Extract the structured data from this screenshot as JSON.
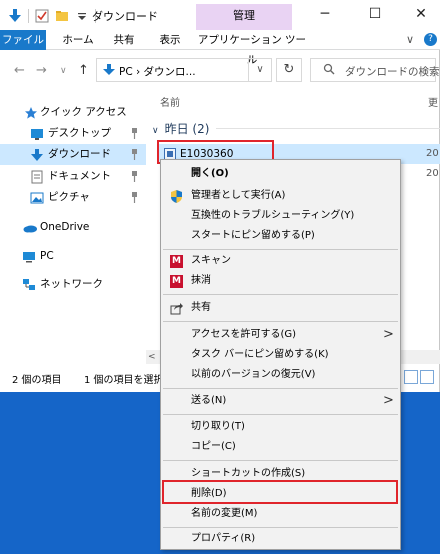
{
  "window": {
    "title": "ダウンロード",
    "manage_tab": "管理",
    "min": "─",
    "max": "☐",
    "close": "✕"
  },
  "ribbon": {
    "tabs": [
      "ファイル",
      "ホーム",
      "共有",
      "表示",
      "アプリケーション ツール"
    ],
    "expand": "∨",
    "help": "?"
  },
  "address": {
    "back": "←",
    "forward": "→",
    "recent": "∨",
    "up": "↑",
    "path": "PC  ›  ダウンロ...",
    "dropdown": "∨",
    "refresh": "↻",
    "search_placeholder": "ダウンロードの検索"
  },
  "nav": {
    "items": [
      {
        "label": "クイック アクセス",
        "icon": "star-icon"
      },
      {
        "label": "デスクトップ",
        "icon": "desktop-folder-icon",
        "pinned": true
      },
      {
        "label": "ダウンロード",
        "icon": "download-folder-icon",
        "pinned": true,
        "selected": true
      },
      {
        "label": "ドキュメント",
        "icon": "documents-folder-icon",
        "pinned": true
      },
      {
        "label": "ピクチャ",
        "icon": "pictures-folder-icon",
        "pinned": true
      },
      {
        "label": "OneDrive",
        "icon": "onedrive-icon"
      },
      {
        "label": "PC",
        "icon": "pc-icon"
      },
      {
        "label": "ネットワーク",
        "icon": "network-icon"
      }
    ],
    "pin_glyph": "📌"
  },
  "content": {
    "column_name": "名前",
    "column_more": "更",
    "group_label": "昨日 (2)",
    "group_chevron": "∨",
    "selected_file": "E1030360",
    "selected_file_date": "20",
    "second_file_date": "20"
  },
  "status": {
    "item_count": "2 個の項目",
    "selected_count": "1 個の項目を選択",
    "scroll_left": "<"
  },
  "context_menu": {
    "items": [
      {
        "label": "開く(O)",
        "bold": true
      },
      {
        "label": "管理者として実行(A)",
        "icon": "uac-shield-icon"
      },
      {
        "label": "互換性のトラブルシューティング(Y)"
      },
      {
        "label": "スタートにピン留めする(P)"
      },
      {
        "sep": true
      },
      {
        "label": "スキャン",
        "icon": "mcafee-icon"
      },
      {
        "label": "抹消",
        "icon": "mcafee-icon"
      },
      {
        "sep": true
      },
      {
        "label": "共有",
        "icon": "share-icon"
      },
      {
        "sep": true
      },
      {
        "label": "アクセスを許可する(G)",
        "submenu": true
      },
      {
        "label": "タスク バーにピン留めする(K)"
      },
      {
        "label": "以前のバージョンの復元(V)"
      },
      {
        "sep": true
      },
      {
        "label": "送る(N)",
        "submenu": true
      },
      {
        "sep": true
      },
      {
        "label": "切り取り(T)"
      },
      {
        "label": "コピー(C)"
      },
      {
        "sep": true
      },
      {
        "label": "ショートカットの作成(S)"
      },
      {
        "label": "削除(D)",
        "highlighted": true
      },
      {
        "label": "名前の変更(M)"
      },
      {
        "sep": true
      },
      {
        "label": "プロパティ(R)"
      }
    ],
    "submenu_glyph": ">",
    "mcafee_glyph": "M"
  },
  "colors": {
    "file_tab": "#1979ca",
    "manage_tab": "#e9d3f3",
    "selection": "#cce8ff",
    "highlight_box": "#e0252c",
    "desktop": "#1565c8",
    "mcafee": "#c8102e"
  }
}
